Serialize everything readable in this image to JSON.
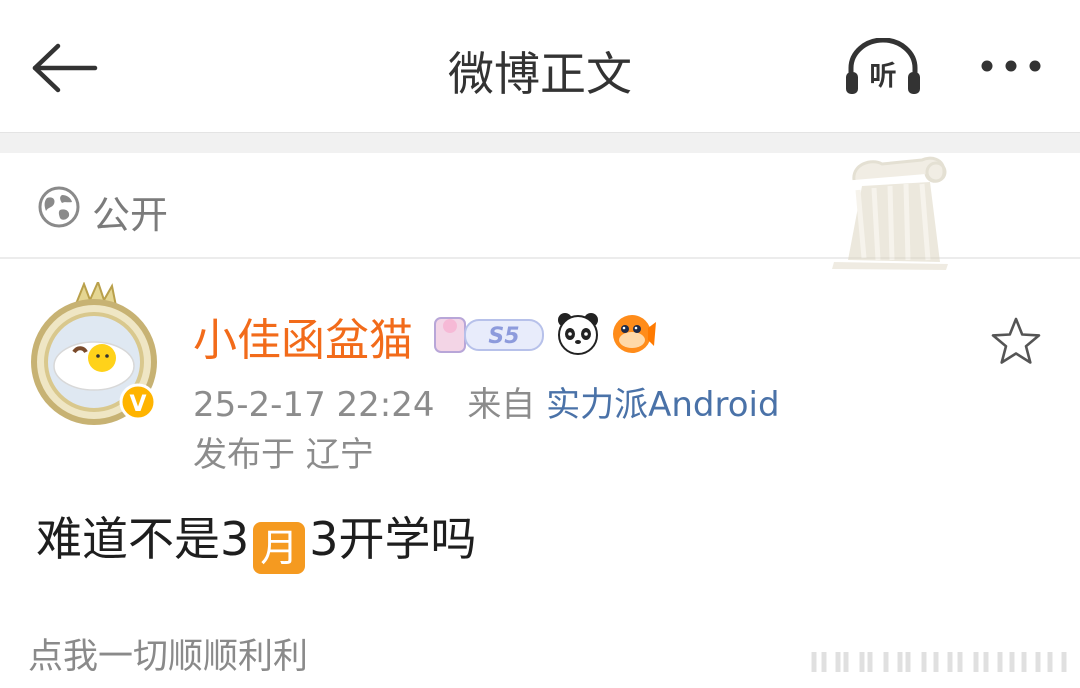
{
  "header": {
    "title": "微博正文",
    "listen_label": "听"
  },
  "visibility": {
    "label": "公开"
  },
  "post": {
    "author": {
      "name": "小佳函盆猫",
      "level_badge": "S5",
      "verified_mark": "V"
    },
    "timestamp": "25-2-17 22:24",
    "source_prefix": "来自",
    "source": "实力派Android",
    "location": "发布于 辽宁",
    "content": {
      "before": "难道不是3",
      "emoji": "月",
      "after": "3开学吗"
    }
  },
  "footer": {
    "text": "点我一切顺顺利利"
  },
  "colors": {
    "username": "#f26b1a",
    "source_link": "#4a72a8",
    "month_emoji": "#f59a20"
  },
  "icons": [
    "back-arrow-icon",
    "headphones-icon",
    "more-dots-icon",
    "globe-icon",
    "column-decoration-icon",
    "verified-icon",
    "panda-icon",
    "fish-icon",
    "star-icon"
  ]
}
